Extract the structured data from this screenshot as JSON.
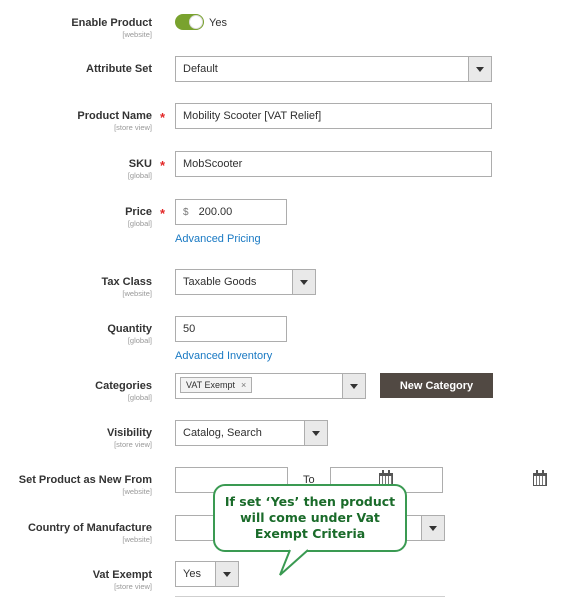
{
  "fields": {
    "enable_product": {
      "label": "Enable Product",
      "scope": "[website]",
      "value": "Yes"
    },
    "attribute_set": {
      "label": "Attribute Set",
      "value": "Default"
    },
    "product_name": {
      "label": "Product Name",
      "scope": "[store view]",
      "value": "Mobility Scooter [VAT Relief]",
      "required_mark": "*"
    },
    "sku": {
      "label": "SKU",
      "scope": "[global]",
      "value": "MobScooter",
      "required_mark": "*"
    },
    "price": {
      "label": "Price",
      "scope": "[global]",
      "currency": "$",
      "value": "200.00",
      "required_mark": "*",
      "link": "Advanced Pricing"
    },
    "tax_class": {
      "label": "Tax Class",
      "scope": "[website]",
      "value": "Taxable Goods"
    },
    "quantity": {
      "label": "Quantity",
      "scope": "[global]",
      "value": "50",
      "link": "Advanced Inventory"
    },
    "categories": {
      "label": "Categories",
      "scope": "[global]",
      "chip": "VAT Exempt",
      "chip_remove": "×",
      "button": "New Category"
    },
    "visibility": {
      "label": "Visibility",
      "scope": "[store view]",
      "value": "Catalog, Search"
    },
    "new_from": {
      "label": "Set Product as New From",
      "scope": "[website]",
      "to_label": "To"
    },
    "country": {
      "label": "Country of Manufacture",
      "scope": "[website]"
    },
    "vat_exempt": {
      "label": "Vat Exempt",
      "scope": "[store view]",
      "value": "Yes"
    }
  },
  "callout": {
    "line1": "If set ‘Yes’ then product",
    "line2": "will come under Vat",
    "line3": "Exempt Criteria"
  },
  "colors": {
    "toggle_on": "#79a22e",
    "button_bg": "#514943",
    "link": "#1979c3",
    "required": "#e22626",
    "callout_border": "#3a9a52",
    "callout_text": "#1a6b2a"
  }
}
